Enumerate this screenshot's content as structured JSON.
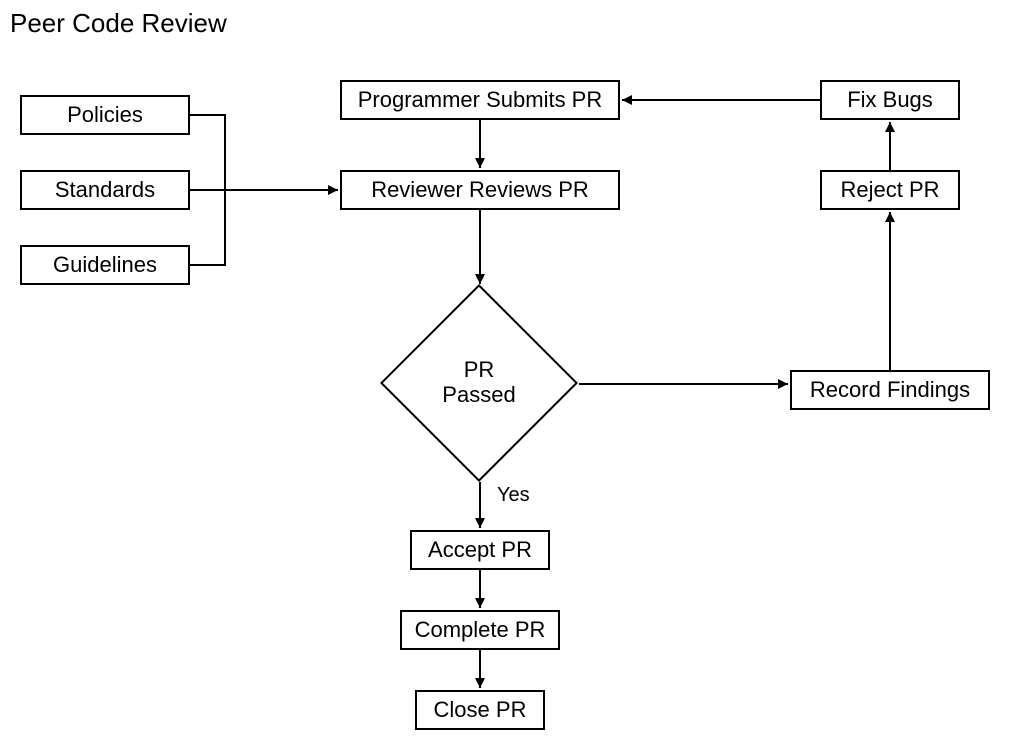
{
  "title": "Peer Code Review",
  "nodes": {
    "policies": "Policies",
    "standards": "Standards",
    "guidelines": "Guidelines",
    "submit": "Programmer Submits PR",
    "review": "Reviewer Reviews PR",
    "decision_line1": "PR",
    "decision_line2": "Passed",
    "accept": "Accept PR",
    "complete": "Complete PR",
    "close": "Close PR",
    "record": "Record Findings",
    "reject": "Reject PR",
    "fix": "Fix Bugs"
  },
  "edges": {
    "yes": "Yes"
  }
}
